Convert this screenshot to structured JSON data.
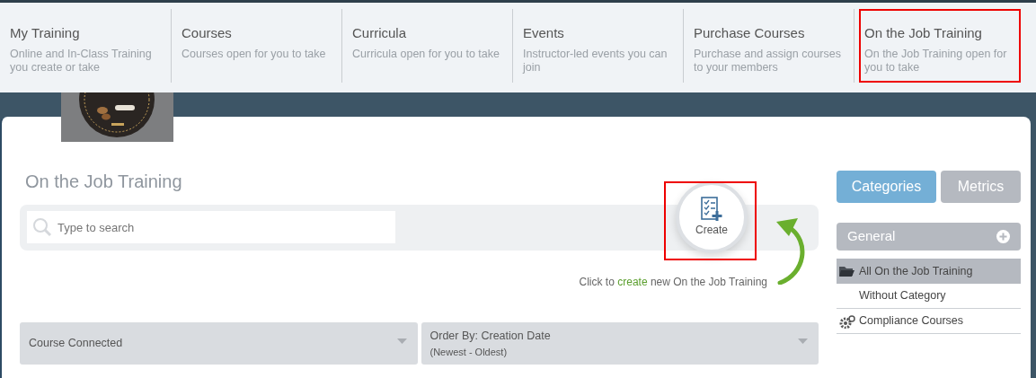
{
  "nav_menu": [
    {
      "title": "My Training",
      "description": "Online and In-Class Training you create or take",
      "highlighted": false
    },
    {
      "title": "Courses",
      "description": "Courses open for you to take",
      "highlighted": false
    },
    {
      "title": "Curricula",
      "description": "Curricula open for you to take",
      "highlighted": false
    },
    {
      "title": "Events",
      "description": "Instructor-led events you can join",
      "highlighted": false
    },
    {
      "title": "Purchase Courses",
      "description": "Purchase and assign courses to your members",
      "highlighted": false
    },
    {
      "title": "On the Job Training",
      "description": "On the Job Training open for you to take",
      "highlighted": true
    }
  ],
  "page_title": "On the Job Training",
  "search": {
    "placeholder": "Type to search"
  },
  "create_button": {
    "label": "Create",
    "highlighted": true
  },
  "create_hint": {
    "before": "Click to",
    "link": "create",
    "after": "new On the Job Training"
  },
  "filters": [
    {
      "label": "Course Connected"
    },
    {
      "label": "Order By: Creation Date",
      "sublabel": "(Newest - Oldest)"
    }
  ],
  "side_tabs": [
    {
      "label": "Categories",
      "selected": true
    },
    {
      "label": "Metrics",
      "selected": false
    }
  ],
  "category_group": {
    "title": "General"
  },
  "categories": [
    {
      "label": "All On the Job Training",
      "selected": true,
      "kind": "folder"
    },
    {
      "label": "Without Category",
      "selected": false
    },
    {
      "label": "Compliance Courses",
      "selected": false,
      "kind": "gears"
    }
  ]
}
